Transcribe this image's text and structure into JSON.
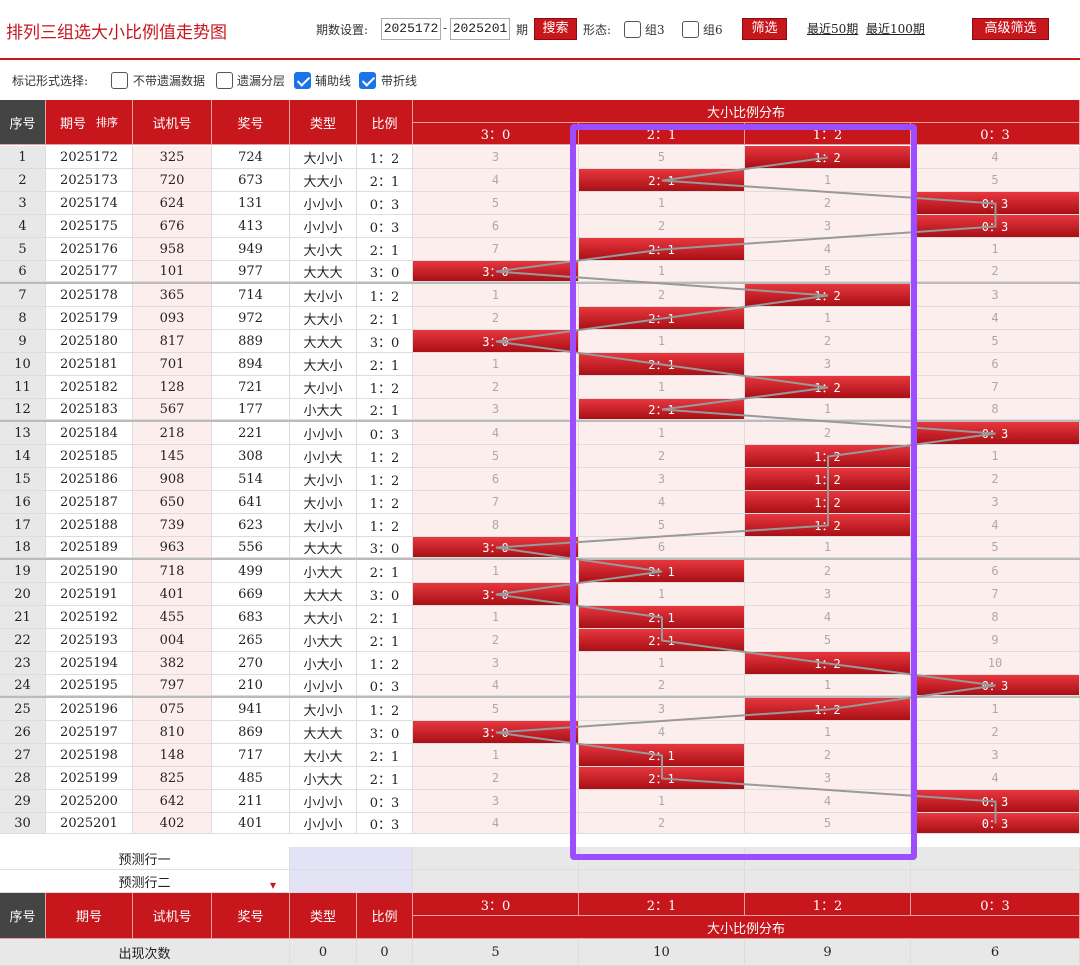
{
  "header": {
    "title": "排列三组选大小比例值走势图",
    "period_label": "期数设置:",
    "start_period": "2025172",
    "dash": "-",
    "end_period": "2025201",
    "period_unit": "期",
    "search_label": "搜索",
    "form_label": "形态:",
    "group3_label": "组3",
    "group6_label": "组6",
    "filter_label": "筛选",
    "recent50": "最近50期",
    "recent100": "最近100期",
    "advanced_label": "高级筛选"
  },
  "options": {
    "label": "标记形式选择:",
    "items": [
      {
        "label": "不带遗漏数据",
        "checked": false
      },
      {
        "label": "遗漏分层",
        "checked": false
      },
      {
        "label": "辅助线",
        "checked": true
      },
      {
        "label": "带折线",
        "checked": true
      }
    ]
  },
  "table": {
    "headers": {
      "seq": "序号",
      "period": "期号",
      "sort": "排序",
      "trial": "试机号",
      "award": "奖号",
      "type": "类型",
      "ratio": "比例",
      "dist_title": "大小比例分布"
    },
    "dist_columns": [
      "3：0",
      "2：1",
      "1：2",
      "0：3"
    ],
    "rows": [
      {
        "seq": "1",
        "period": "2025172",
        "trial": "325",
        "award": "724",
        "type": "大小小",
        "ratio": "1：2",
        "dist": [
          "3",
          "5",
          "1：2",
          "4"
        ]
      },
      {
        "seq": "2",
        "period": "2025173",
        "trial": "720",
        "award": "673",
        "type": "大大小",
        "ratio": "2：1",
        "dist": [
          "4",
          "2：1",
          "1",
          "5"
        ]
      },
      {
        "seq": "3",
        "period": "2025174",
        "trial": "624",
        "award": "131",
        "type": "小小小",
        "ratio": "0：3",
        "dist": [
          "5",
          "1",
          "2",
          "0：3"
        ]
      },
      {
        "seq": "4",
        "period": "2025175",
        "trial": "676",
        "award": "413",
        "type": "小小小",
        "ratio": "0：3",
        "dist": [
          "6",
          "2",
          "3",
          "0：3"
        ]
      },
      {
        "seq": "5",
        "period": "2025176",
        "trial": "958",
        "award": "949",
        "type": "大小大",
        "ratio": "2：1",
        "dist": [
          "7",
          "2：1",
          "4",
          "1"
        ]
      },
      {
        "seq": "6",
        "period": "2025177",
        "trial": "101",
        "award": "977",
        "type": "大大大",
        "ratio": "3：0",
        "dist": [
          "3：0",
          "1",
          "5",
          "2"
        ]
      },
      {
        "seq": "7",
        "period": "2025178",
        "trial": "365",
        "award": "714",
        "type": "大小小",
        "ratio": "1：2",
        "dist": [
          "1",
          "2",
          "1：2",
          "3"
        ]
      },
      {
        "seq": "8",
        "period": "2025179",
        "trial": "093",
        "award": "972",
        "type": "大大小",
        "ratio": "2：1",
        "dist": [
          "2",
          "2：1",
          "1",
          "4"
        ]
      },
      {
        "seq": "9",
        "period": "2025180",
        "trial": "817",
        "award": "889",
        "type": "大大大",
        "ratio": "3：0",
        "dist": [
          "3：0",
          "1",
          "2",
          "5"
        ]
      },
      {
        "seq": "10",
        "period": "2025181",
        "trial": "701",
        "award": "894",
        "type": "大大小",
        "ratio": "2：1",
        "dist": [
          "1",
          "2：1",
          "3",
          "6"
        ]
      },
      {
        "seq": "11",
        "period": "2025182",
        "trial": "128",
        "award": "721",
        "type": "大小小",
        "ratio": "1：2",
        "dist": [
          "2",
          "1",
          "1：2",
          "7"
        ]
      },
      {
        "seq": "12",
        "period": "2025183",
        "trial": "567",
        "award": "177",
        "type": "小大大",
        "ratio": "2：1",
        "dist": [
          "3",
          "2：1",
          "1",
          "8"
        ]
      },
      {
        "seq": "13",
        "period": "2025184",
        "trial": "218",
        "award": "221",
        "type": "小小小",
        "ratio": "0：3",
        "dist": [
          "4",
          "1",
          "2",
          "0：3"
        ]
      },
      {
        "seq": "14",
        "period": "2025185",
        "trial": "145",
        "award": "308",
        "type": "小小大",
        "ratio": "1：2",
        "dist": [
          "5",
          "2",
          "1：2",
          "1"
        ]
      },
      {
        "seq": "15",
        "period": "2025186",
        "trial": "908",
        "award": "514",
        "type": "大小小",
        "ratio": "1：2",
        "dist": [
          "6",
          "3",
          "1：2",
          "2"
        ]
      },
      {
        "seq": "16",
        "period": "2025187",
        "trial": "650",
        "award": "641",
        "type": "大小小",
        "ratio": "1：2",
        "dist": [
          "7",
          "4",
          "1：2",
          "3"
        ]
      },
      {
        "seq": "17",
        "period": "2025188",
        "trial": "739",
        "award": "623",
        "type": "大小小",
        "ratio": "1：2",
        "dist": [
          "8",
          "5",
          "1：2",
          "4"
        ]
      },
      {
        "seq": "18",
        "period": "2025189",
        "trial": "963",
        "award": "556",
        "type": "大大大",
        "ratio": "3：0",
        "dist": [
          "3：0",
          "6",
          "1",
          "5"
        ]
      },
      {
        "seq": "19",
        "period": "2025190",
        "trial": "718",
        "award": "499",
        "type": "小大大",
        "ratio": "2：1",
        "dist": [
          "1",
          "2：1",
          "2",
          "6"
        ]
      },
      {
        "seq": "20",
        "period": "2025191",
        "trial": "401",
        "award": "669",
        "type": "大大大",
        "ratio": "3：0",
        "dist": [
          "3：0",
          "1",
          "3",
          "7"
        ]
      },
      {
        "seq": "21",
        "period": "2025192",
        "trial": "455",
        "award": "683",
        "type": "大大小",
        "ratio": "2：1",
        "dist": [
          "1",
          "2：1",
          "4",
          "8"
        ]
      },
      {
        "seq": "22",
        "period": "2025193",
        "trial": "004",
        "award": "265",
        "type": "小大大",
        "ratio": "2：1",
        "dist": [
          "2",
          "2：1",
          "5",
          "9"
        ]
      },
      {
        "seq": "23",
        "period": "2025194",
        "trial": "382",
        "award": "270",
        "type": "小大小",
        "ratio": "1：2",
        "dist": [
          "3",
          "1",
          "1：2",
          "10"
        ]
      },
      {
        "seq": "24",
        "period": "2025195",
        "trial": "797",
        "award": "210",
        "type": "小小小",
        "ratio": "0：3",
        "dist": [
          "4",
          "2",
          "1",
          "0：3"
        ]
      },
      {
        "seq": "25",
        "period": "2025196",
        "trial": "075",
        "award": "941",
        "type": "大小小",
        "ratio": "1：2",
        "dist": [
          "5",
          "3",
          "1：2",
          "1"
        ]
      },
      {
        "seq": "26",
        "period": "2025197",
        "trial": "810",
        "award": "869",
        "type": "大大大",
        "ratio": "3：0",
        "dist": [
          "3：0",
          "4",
          "1",
          "2"
        ]
      },
      {
        "seq": "27",
        "period": "2025198",
        "trial": "148",
        "award": "717",
        "type": "大小大",
        "ratio": "2：1",
        "dist": [
          "1",
          "2：1",
          "2",
          "3"
        ]
      },
      {
        "seq": "28",
        "period": "2025199",
        "trial": "825",
        "award": "485",
        "type": "小大大",
        "ratio": "2：1",
        "dist": [
          "2",
          "2：1",
          "3",
          "4"
        ]
      },
      {
        "seq": "29",
        "period": "2025200",
        "trial": "642",
        "award": "211",
        "type": "小小小",
        "ratio": "0：3",
        "dist": [
          "3",
          "1",
          "4",
          "0：3"
        ]
      },
      {
        "seq": "30",
        "period": "2025201",
        "trial": "402",
        "award": "401",
        "type": "小小小",
        "ratio": "0：3",
        "dist": [
          "4",
          "2",
          "5",
          "0：3"
        ]
      }
    ],
    "predict1": "预测行一",
    "predict2": "预测行二",
    "footer": {
      "count_label": "出现次数",
      "type_count": "0",
      "ratio_count": "0",
      "dist_counts": [
        "5",
        "10",
        "9",
        "6"
      ]
    }
  },
  "chart_data": {
    "type": "table",
    "title": "排列三组选大小比例值走势图",
    "categories": [
      "3：0",
      "2：1",
      "1：2",
      "0：3"
    ],
    "x": [
      "2025172",
      "2025173",
      "2025174",
      "2025175",
      "2025176",
      "2025177",
      "2025178",
      "2025179",
      "2025180",
      "2025181",
      "2025182",
      "2025183",
      "2025184",
      "2025185",
      "2025186",
      "2025187",
      "2025188",
      "2025189",
      "2025190",
      "2025191",
      "2025192",
      "2025193",
      "2025194",
      "2025195",
      "2025196",
      "2025197",
      "2025198",
      "2025199",
      "2025200",
      "2025201"
    ],
    "values": [
      "1：2",
      "2：1",
      "0：3",
      "0：3",
      "2：1",
      "3：0",
      "1：2",
      "2：1",
      "3：0",
      "2：1",
      "1：2",
      "2：1",
      "0：3",
      "1：2",
      "1：2",
      "1：2",
      "1：2",
      "3：0",
      "2：1",
      "3：0",
      "2：1",
      "2：1",
      "1：2",
      "0：3",
      "1：2",
      "3：0",
      "2：1",
      "2：1",
      "0：3",
      "0：3"
    ],
    "counts": [
      5,
      10,
      9,
      6
    ]
  },
  "colors": {
    "accent": "#c8161d",
    "highlight_box": "#9b4dff",
    "checkbox": "#1a73e8"
  }
}
